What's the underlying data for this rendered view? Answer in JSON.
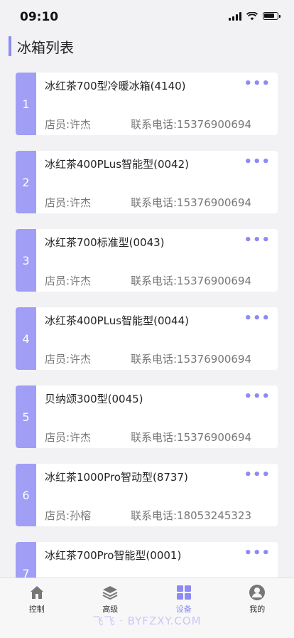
{
  "status": {
    "time": "09:10"
  },
  "page": {
    "title": "冰箱列表"
  },
  "cards": [
    {
      "index": "1",
      "name": "冰红茶700型冷暖冰箱(4140)",
      "staff": "店员:许杰",
      "phone": "联系电话:15376900694",
      "more": "•••"
    },
    {
      "index": "2",
      "name": "冰红茶400PLus智能型(0042)",
      "staff": "店员:许杰",
      "phone": "联系电话:15376900694",
      "more": "•••"
    },
    {
      "index": "3",
      "name": "冰红茶700标准型(0043)",
      "staff": "店员:许杰",
      "phone": "联系电话:15376900694",
      "more": "•••"
    },
    {
      "index": "4",
      "name": "冰红茶400PLus智能型(0044)",
      "staff": "店员:许杰",
      "phone": "联系电话:15376900694",
      "more": "•••"
    },
    {
      "index": "5",
      "name": "贝纳颂300型(0045)",
      "staff": "店员:许杰",
      "phone": "联系电话:15376900694",
      "more": "•••"
    },
    {
      "index": "6",
      "name": "冰红茶1000Pro智动型(8737)",
      "staff": "店员:孙榕",
      "phone": "联系电话:18053245323",
      "more": "•••"
    },
    {
      "index": "7",
      "name": "冰红茶700Pro智能型(0001)",
      "staff": "",
      "phone": "",
      "more": "•••"
    }
  ],
  "tabbar": {
    "control": "控制",
    "advanced": "高级",
    "device": "设备",
    "mine": "我的"
  },
  "watermark": "飞飞 · BYFZXY.COM",
  "colors": {
    "accent": "#8d8bf3",
    "index_bg": "#a09ef5",
    "background": "#f2f2f5"
  },
  "icons": {
    "control": "home-icon",
    "advanced": "layers-icon",
    "device": "grid-icon",
    "mine": "user-icon"
  }
}
